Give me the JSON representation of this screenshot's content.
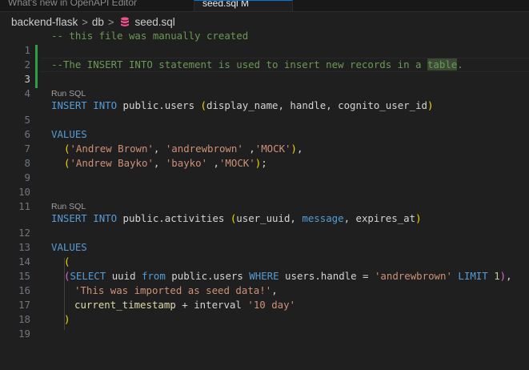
{
  "tabs": [
    {
      "label": "What's new in OpenAPI Editor"
    },
    {
      "label": "seed.sql M"
    }
  ],
  "breadcrumb": {
    "folder1": "backend-flask",
    "folder2": "db",
    "file": "seed.sql",
    "sep": ">"
  },
  "codelens": {
    "run1": "Run SQL",
    "run2": "Run SQL"
  },
  "line_numbers": [
    "1",
    "2",
    "3",
    "4",
    "5",
    "6",
    "7",
    "8",
    "9",
    "10",
    "11",
    "12",
    "13",
    "14",
    "15",
    "16",
    "17",
    "18",
    "19"
  ],
  "code": {
    "l1": "-- this file was manually created",
    "l3a": "--The INSERT INTO statement is used to insert new records in a ",
    "l3b": "table",
    "l3c": ".",
    "l5": {
      "kw1": "INSERT",
      "kw2": "INTO",
      "t1": "public.users ",
      "p1": "(",
      "cols": "display_name, handle, cognito_user_id",
      "p2": ")"
    },
    "l7": "VALUES",
    "l8": {
      "p1": "(",
      "s1": "'Andrew Brown'",
      "c1": ", ",
      "s2": "'andrewbrown'",
      "c2": " ,",
      "s3": "'MOCK'",
      "p2": ")",
      "end": ","
    },
    "l9": {
      "p1": "(",
      "s1": "'Andrew Bayko'",
      "c1": ", ",
      "s2": "'bayko'",
      "c2": " ,",
      "s3": "'MOCK'",
      "p2": ")",
      "end": ";"
    },
    "l12": {
      "kw1": "INSERT",
      "kw2": "INTO",
      "t1": "public.activities ",
      "p1": "(",
      "c1": "user_uuid, ",
      "kw3": "message",
      "c2": ", expires_at",
      "p2": ")"
    },
    "l14": "VALUES",
    "l15": "(",
    "l16": {
      "p1": "(",
      "kw1": "SELECT",
      "t1": " uuid ",
      "kw2": "from",
      "t2": " public.users ",
      "kw3": "WHERE",
      "t3": " users.handle = ",
      "s1": "'andrewbrown'",
      "sp": " ",
      "kw4": "LIMIT",
      "sp2": " ",
      "n1": "1",
      "p2": ")",
      "end": ","
    },
    "l17": {
      "s1": "'This was imported as seed data!'",
      "end": ","
    },
    "l18": {
      "f1": "current_timestamp",
      "t1": " + interval ",
      "s1": "'10 day'"
    },
    "l19": ")"
  },
  "colors": {
    "background": "#1f1f1f",
    "comment": "#6a9955",
    "keyword": "#569cd6",
    "string": "#ce9178",
    "modified_gutter": "#2ea043"
  }
}
